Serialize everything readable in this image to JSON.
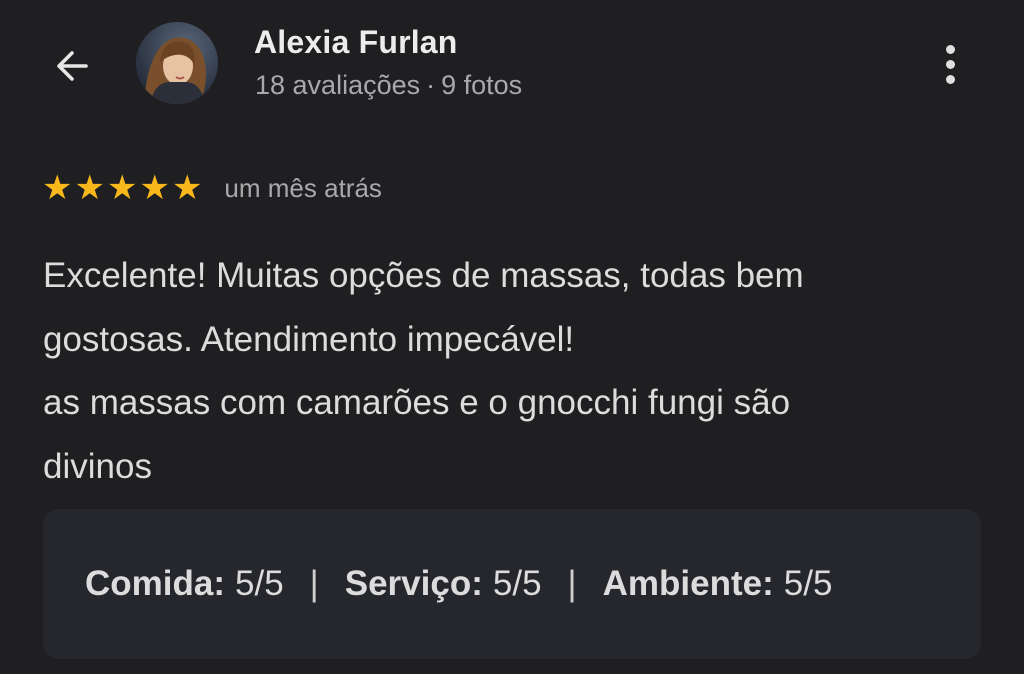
{
  "header": {
    "user_name": "Alexia Furlan",
    "reviews_count": "18 avaliações",
    "separator": "·",
    "photos_count": "9 fotos"
  },
  "review": {
    "rating": 5,
    "rating_max": 5,
    "star_glyph": "★",
    "time_ago": "um mês atrás",
    "text_lines": [
      "Excelente! Muitas opções de massas, todas bem",
      "gostosas. Atendimento impecável!",
      "as massas com camarões e o gnocchi fungi são",
      "divinos"
    ]
  },
  "scores": {
    "divider": "|",
    "items": [
      {
        "label": "Comida:",
        "value": "5/5"
      },
      {
        "label": "Serviço:",
        "value": "5/5"
      },
      {
        "label": "Ambiente:",
        "value": "5/5"
      }
    ]
  },
  "icons": {
    "back": "arrow-left-icon",
    "more": "more-vertical-icon",
    "star": "star-icon"
  },
  "colors": {
    "background": "#1f1f21",
    "star": "#f8b81c",
    "card": "#25272c",
    "secondary_text": "#a9a9ab"
  }
}
